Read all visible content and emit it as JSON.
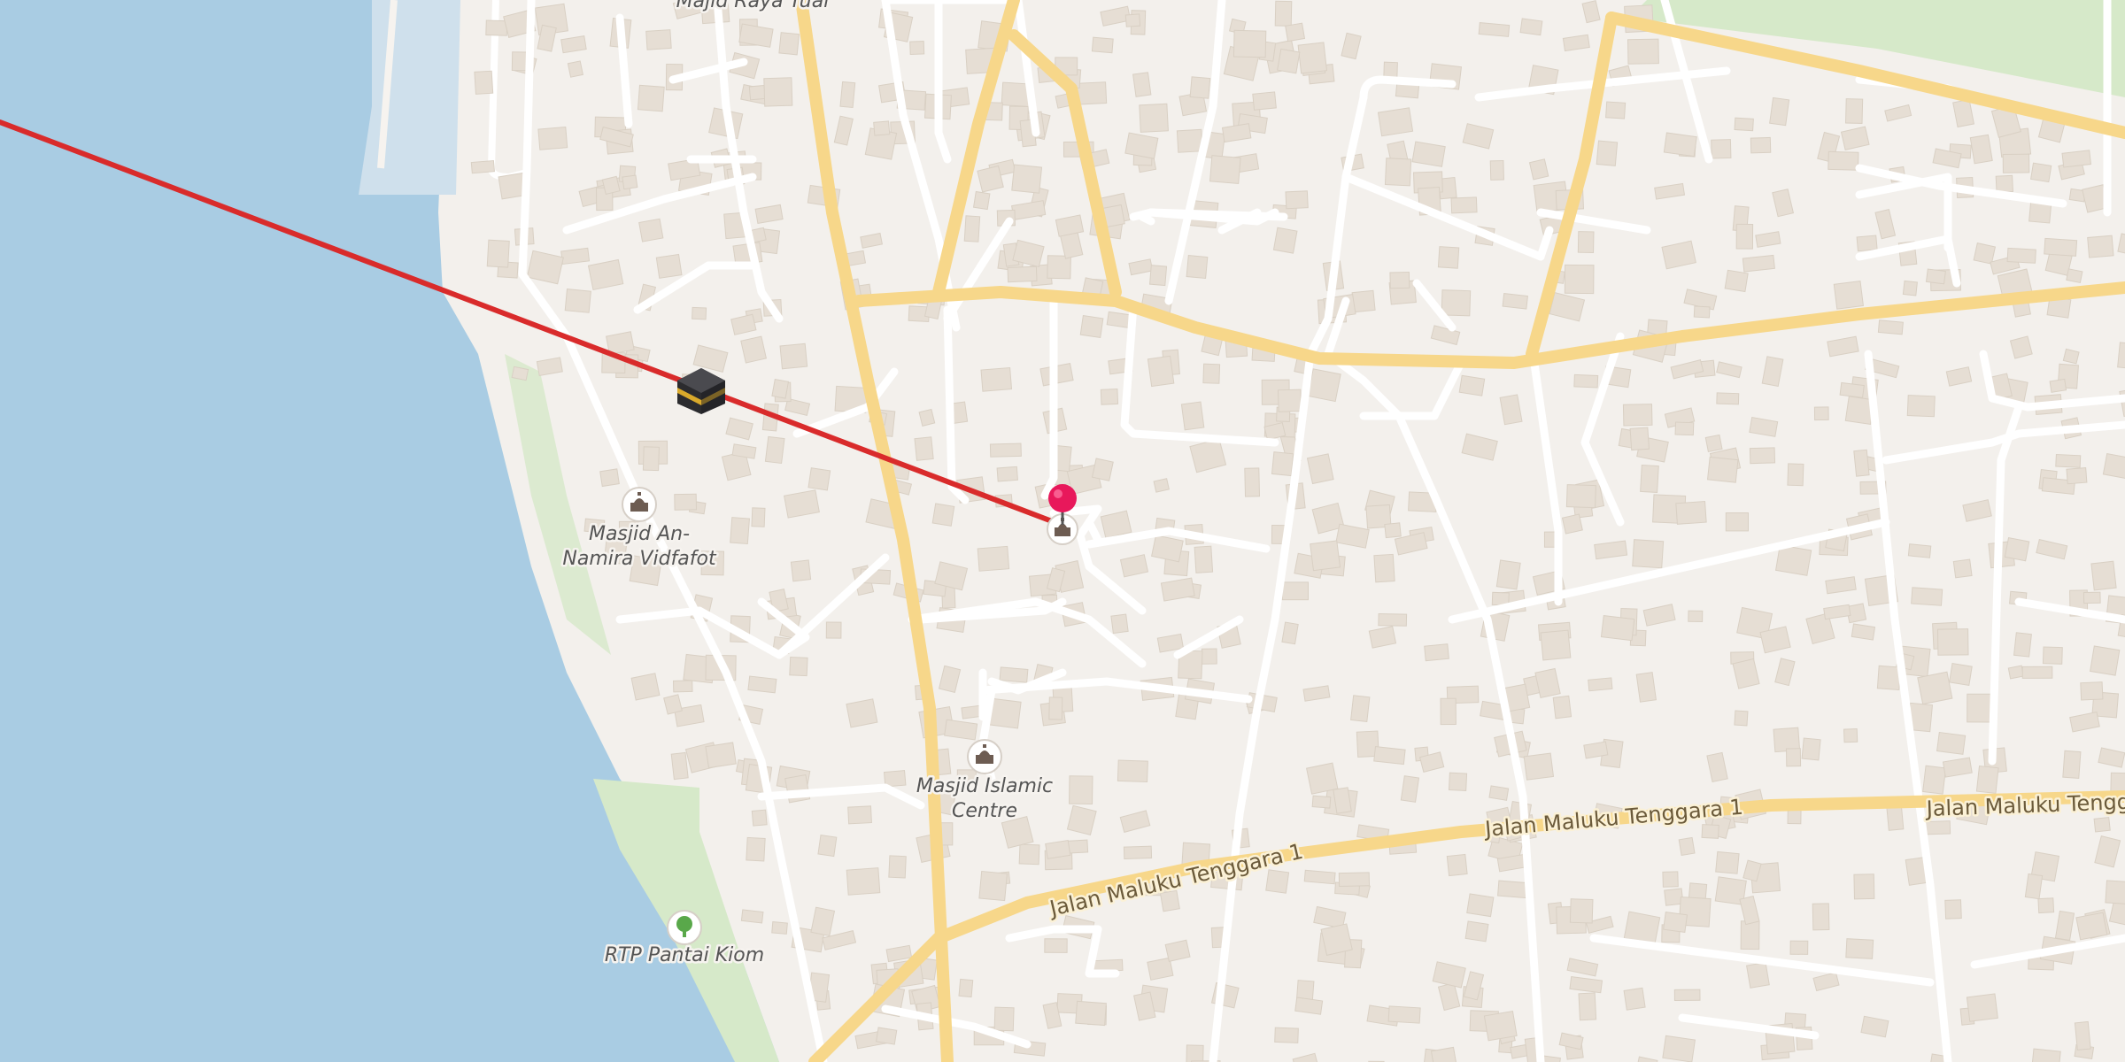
{
  "colors": {
    "water": "#a9cce3",
    "land": "#f3f0ec",
    "park": "#d6e9c9",
    "building": "#e6ded4",
    "major_road": "#f7d78a",
    "minor_road": "#ffffff",
    "qibla_line": "#d92b2b",
    "pin": "#e8185b"
  },
  "labels": {
    "top_cut_label": "Majid Raya Tual",
    "road_a": "Jalan Maluku Tenggara 1",
    "road_b": "Jalan Maluku Tenggara 1",
    "road_c": "Jalan Maluku Tengg"
  },
  "pois": [
    {
      "name_line1": "Masjid An-",
      "name_line2": "Namira Vidfafot",
      "icon": "mosque-icon"
    },
    {
      "name_line1": "Masjid Islamic",
      "name_line2": "Centre",
      "icon": "mosque-icon"
    },
    {
      "name_line1": "RTP Pantai Kiom",
      "name_line2": "",
      "icon": "tree-icon"
    }
  ],
  "markers": {
    "kaaba": "kaaba-icon",
    "location_pin": "location-pin-icon"
  }
}
